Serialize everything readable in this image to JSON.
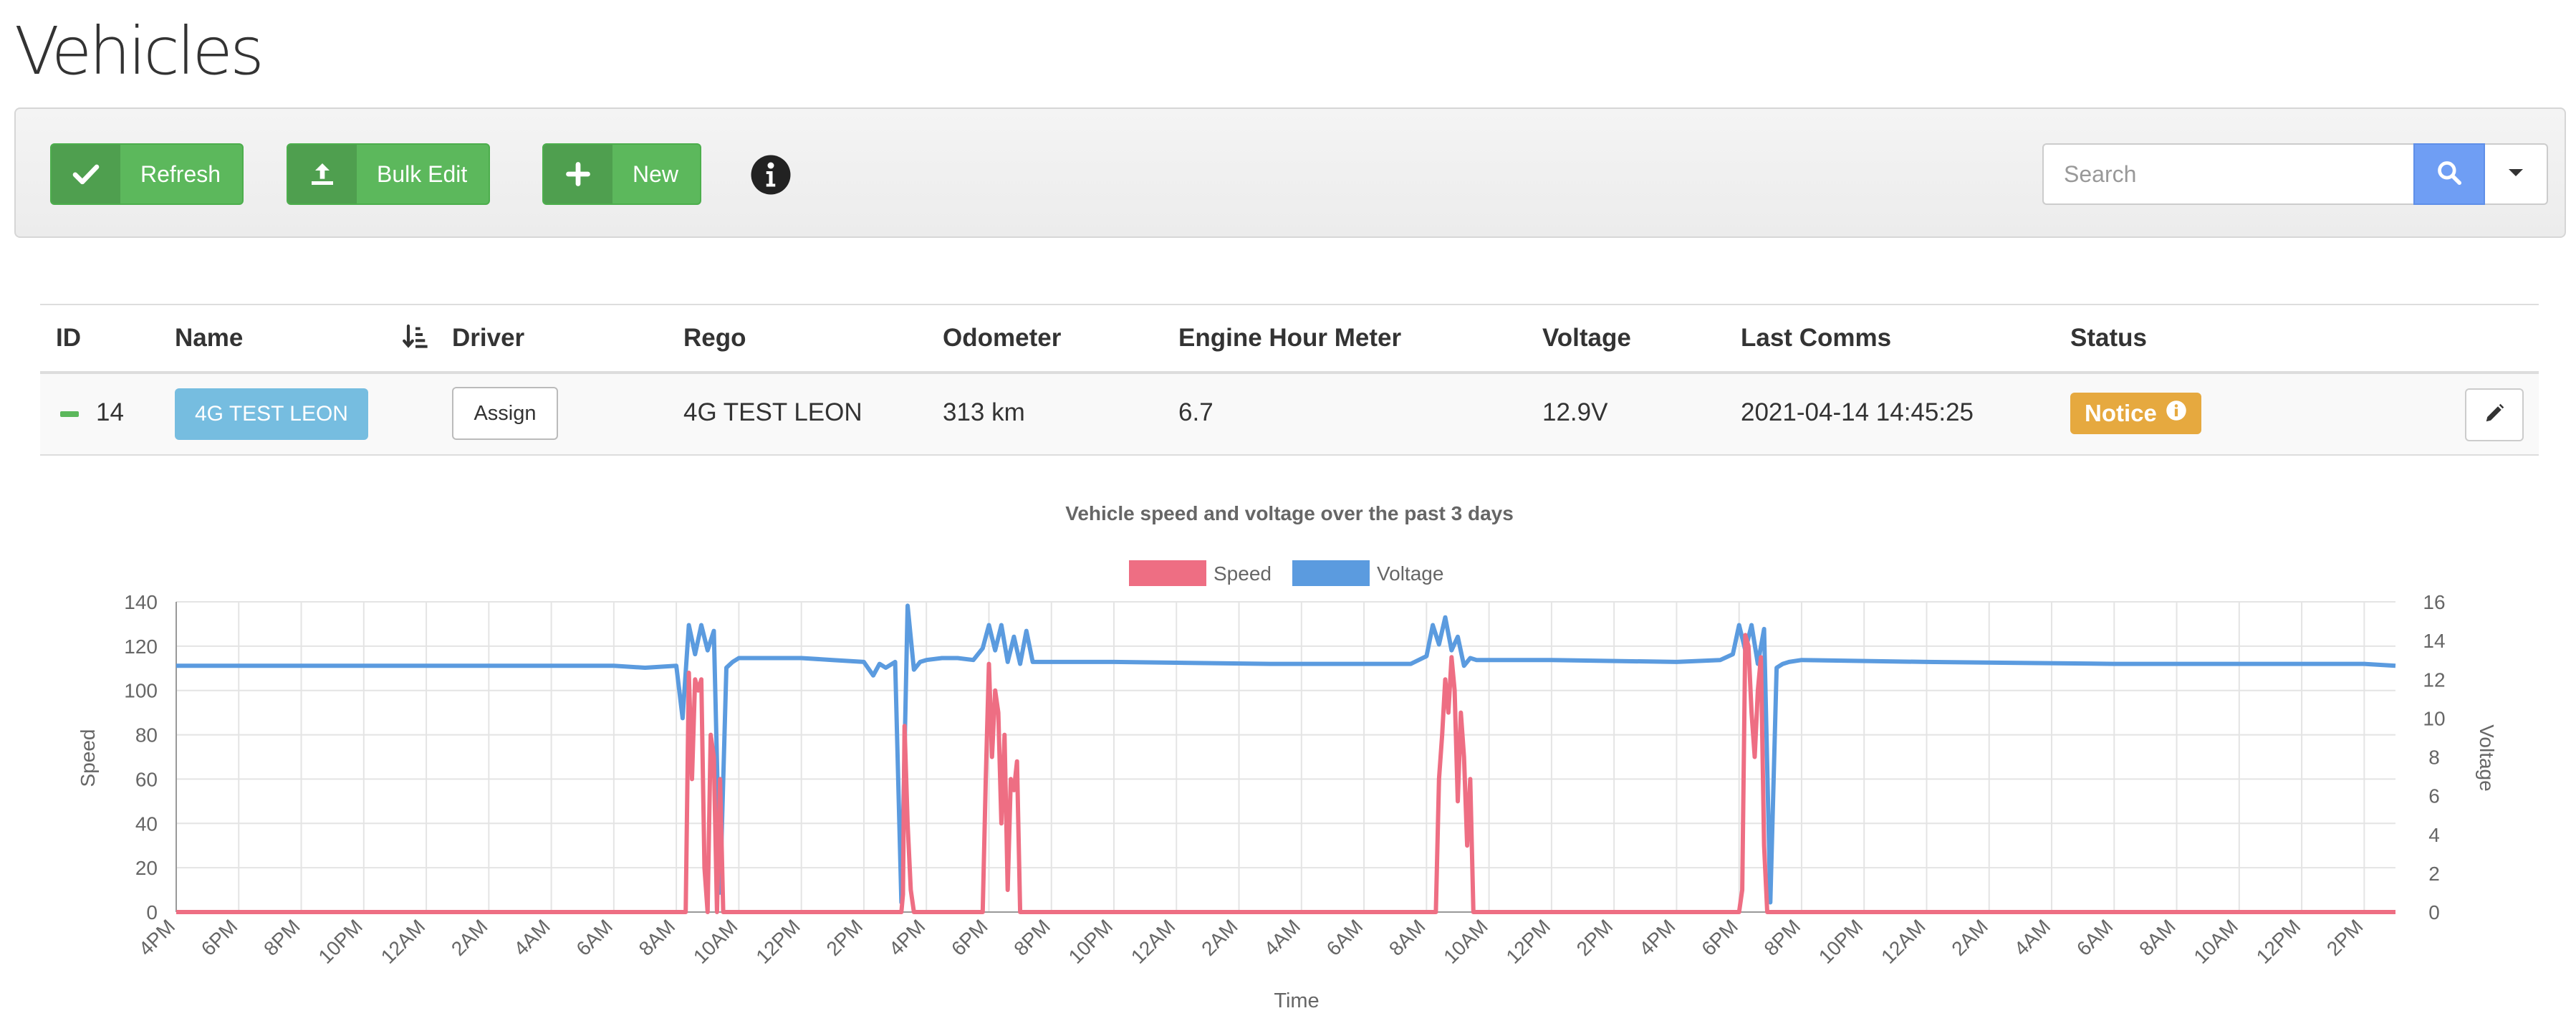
{
  "page": {
    "title": "Vehicles"
  },
  "toolbar": {
    "refresh_label": "Refresh",
    "bulk_edit_label": "Bulk Edit",
    "new_label": "New",
    "search_placeholder": "Search"
  },
  "table": {
    "columns": [
      "ID",
      "Name",
      "Driver",
      "Rego",
      "Odometer",
      "Engine Hour Meter",
      "Voltage",
      "Last Comms",
      "Status"
    ],
    "rows": [
      {
        "id": "14",
        "name": "4G TEST LEON",
        "driver_action": "Assign",
        "rego": "4G TEST LEON",
        "odometer": "313 km",
        "engine_hours": "6.7",
        "voltage": "12.9V",
        "last_comms": "2021-04-14 14:45:25",
        "status": "Notice"
      }
    ]
  },
  "colors": {
    "green": "#5cb85c",
    "speed": "#ee6e83",
    "voltage": "#5b9bdf",
    "notice": "#e6a93f",
    "name_badge": "#76bde0",
    "search": "#6f9ef4"
  },
  "chart_data": {
    "type": "line",
    "title": "Vehicle speed and voltage over the past 3 days",
    "xlabel": "Time",
    "ylabel": "Speed",
    "ylabel_right": "Voltage",
    "ylim": [
      0,
      140
    ],
    "ylim_right": [
      0,
      16
    ],
    "yticks": [
      "0",
      "20",
      "40",
      "60",
      "80",
      "100",
      "120",
      "140"
    ],
    "yticks_right": [
      "0",
      "2",
      "4",
      "6",
      "8",
      "10",
      "12",
      "14",
      "16"
    ],
    "x_ticks": [
      "4PM",
      "6PM",
      "8PM",
      "10PM",
      "12AM",
      "2AM",
      "4AM",
      "6AM",
      "8AM",
      "10AM",
      "12PM",
      "2PM",
      "4PM",
      "6PM",
      "8PM",
      "10PM",
      "12AM",
      "2AM",
      "4AM",
      "6AM",
      "8AM",
      "10AM",
      "12PM",
      "2PM",
      "4PM",
      "6PM",
      "8PM",
      "10PM",
      "12AM",
      "2AM",
      "4AM",
      "6AM",
      "8AM",
      "10AM",
      "12PM",
      "2PM"
    ],
    "x_unit": "hours since 4PM",
    "grid": true,
    "legend_position": "top",
    "series": [
      {
        "name": "Speed",
        "axis": "left",
        "x": [
          0,
          16.3,
          16.4,
          16.5,
          16.6,
          16.7,
          16.8,
          16.9,
          17.0,
          17.1,
          17.2,
          17.3,
          17.4,
          17.5,
          17.6,
          17.7,
          23.2,
          23.25,
          23.3,
          23.4,
          23.5,
          23.6,
          25.8,
          25.9,
          26.0,
          26.1,
          26.2,
          26.3,
          26.4,
          26.5,
          26.6,
          26.7,
          26.8,
          26.9,
          27.0,
          27.1,
          27.2,
          27.3,
          40.3,
          40.4,
          40.5,
          40.6,
          40.7,
          40.8,
          40.9,
          41.0,
          41.1,
          41.2,
          41.3,
          41.4,
          41.5,
          41.6,
          50.0,
          50.1,
          50.2,
          50.3,
          50.4,
          50.5,
          50.6,
          50.7,
          50.8,
          50.9,
          51.0,
          71.0
        ],
        "y": [
          0,
          0,
          108,
          60,
          105,
          100,
          105,
          20,
          0,
          80,
          70,
          0,
          60,
          0,
          0,
          0,
          0,
          8,
          84,
          40,
          10,
          0,
          0,
          60,
          112,
          70,
          100,
          90,
          40,
          80,
          10,
          60,
          55,
          68,
          0,
          0,
          0,
          0,
          0,
          60,
          80,
          105,
          90,
          115,
          100,
          50,
          90,
          70,
          30,
          60,
          0,
          0,
          0,
          10,
          125,
          120,
          90,
          70,
          100,
          115,
          30,
          0,
          0,
          0
        ],
        "y_note": "approximate readings of an oscillating trace"
      },
      {
        "name": "Voltage",
        "axis": "right",
        "x": [
          0,
          13.0,
          14.0,
          15.0,
          16.0,
          16.2,
          16.4,
          16.6,
          16.8,
          17.0,
          17.2,
          17.4,
          17.6,
          17.8,
          18.0,
          19.0,
          20.0,
          21.0,
          22.0,
          22.3,
          22.5,
          22.7,
          23.0,
          23.2,
          23.4,
          23.6,
          23.8,
          24.0,
          24.5,
          25.0,
          25.5,
          25.8,
          26.0,
          26.2,
          26.4,
          26.6,
          26.8,
          27.0,
          27.2,
          27.4,
          28.0,
          30.0,
          35.0,
          39.5,
          40.0,
          40.2,
          40.4,
          40.6,
          40.8,
          41.0,
          41.2,
          41.4,
          41.6,
          41.8,
          42.0,
          44.0,
          48.0,
          49.4,
          49.8,
          50.0,
          50.2,
          50.4,
          50.6,
          50.8,
          51.0,
          51.2,
          51.4,
          51.6,
          52.0,
          56.0,
          62.0,
          70.0,
          71.0
        ],
        "y": [
          12.7,
          12.7,
          12.7,
          12.6,
          12.7,
          10.0,
          14.8,
          13.3,
          14.8,
          13.5,
          14.5,
          1.0,
          12.6,
          12.9,
          13.1,
          13.1,
          13.1,
          13.0,
          12.9,
          12.2,
          12.8,
          12.6,
          12.9,
          0.5,
          15.8,
          12.5,
          12.9,
          13.0,
          13.1,
          13.1,
          13.0,
          13.6,
          14.8,
          13.5,
          14.8,
          12.9,
          14.2,
          12.8,
          14.5,
          12.9,
          12.9,
          12.9,
          12.8,
          12.8,
          13.2,
          14.8,
          13.8,
          15.2,
          13.5,
          14.2,
          12.7,
          13.1,
          13.0,
          13.0,
          13.0,
          13.0,
          12.9,
          13.0,
          13.3,
          14.8,
          13.5,
          14.8,
          12.8,
          14.6,
          0.5,
          12.6,
          12.8,
          12.9,
          13.0,
          12.9,
          12.8,
          12.8,
          12.7
        ]
      }
    ]
  }
}
